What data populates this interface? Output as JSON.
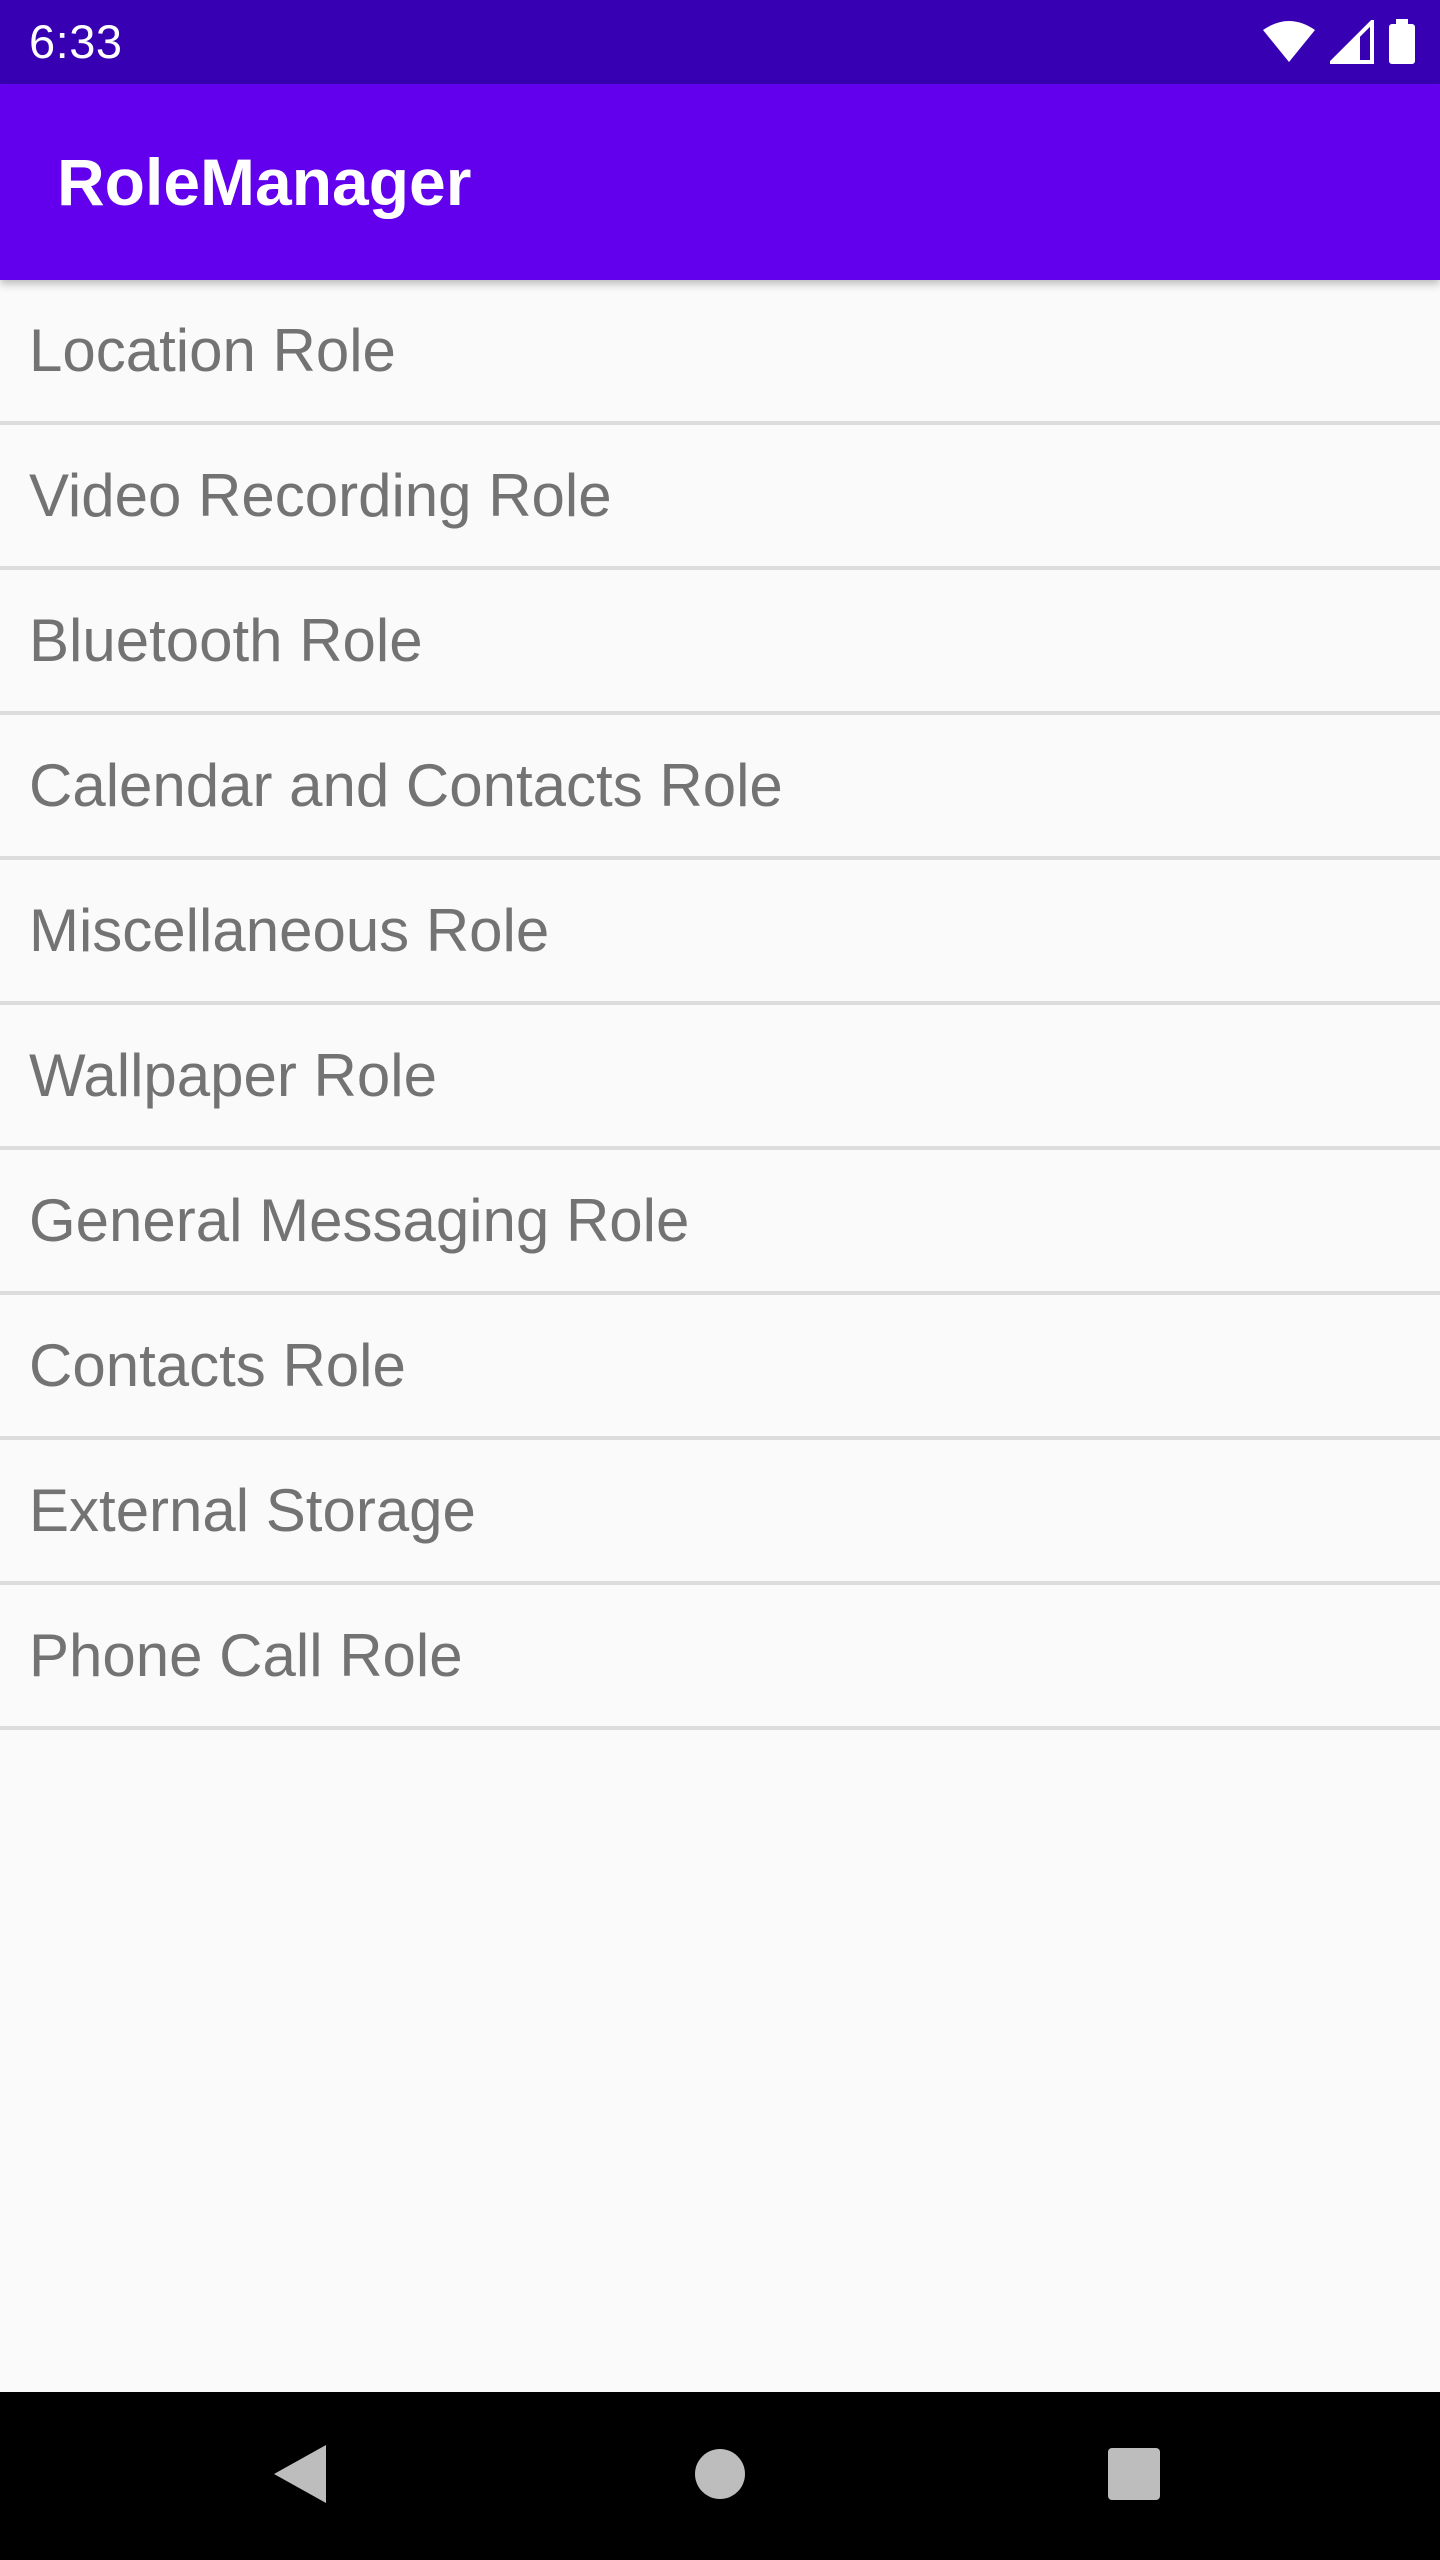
{
  "status_bar": {
    "time": "6:33",
    "icons": [
      "wifi-icon",
      "cellular-signal-icon",
      "battery-icon"
    ]
  },
  "app_bar": {
    "title": "RoleManager",
    "color": "#6200ee"
  },
  "roles": [
    {
      "label": "Location Role"
    },
    {
      "label": "Video Recording Role"
    },
    {
      "label": "Bluetooth Role"
    },
    {
      "label": "Calendar and Contacts Role"
    },
    {
      "label": "Miscellaneous Role"
    },
    {
      "label": "Wallpaper Role"
    },
    {
      "label": "General Messaging Role"
    },
    {
      "label": "Contacts Role"
    },
    {
      "label": "External Storage"
    },
    {
      "label": "Phone Call Role"
    }
  ],
  "nav_bar": {
    "buttons": [
      "back-icon",
      "home-icon",
      "recents-icon"
    ]
  },
  "colors": {
    "status_bar": "#3700b3",
    "app_bar": "#6200ee",
    "background": "#fafafa",
    "item_text": "#737373",
    "divider": "#dcdcdc"
  }
}
